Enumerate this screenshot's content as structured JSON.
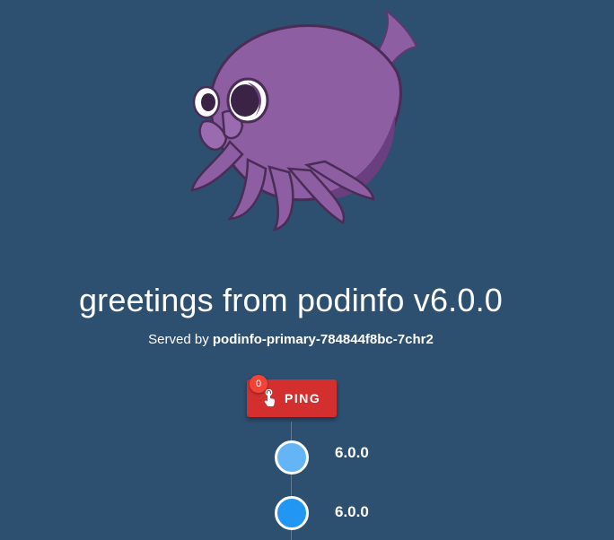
{
  "header": {
    "title": "greetings from podinfo v6.0.0",
    "served_prefix": "Served by ",
    "served_host": "podinfo-primary-784844f8bc-7chr2"
  },
  "ping": {
    "label": "PING",
    "count": "0",
    "icon": "touch-app-icon",
    "color": "#d32f2f",
    "badge_color": "#f44336"
  },
  "timeline": {
    "items": [
      {
        "version": "6.0.0",
        "dot_color": "#64b5f6"
      },
      {
        "version": "6.0.0",
        "dot_color": "#2196f3"
      }
    ]
  },
  "mascot": {
    "icon": "cuttlefish-mascot-icon",
    "color": "#8e5ea2"
  },
  "colors": {
    "background": "#2d4f70",
    "text": "#ffffff"
  }
}
